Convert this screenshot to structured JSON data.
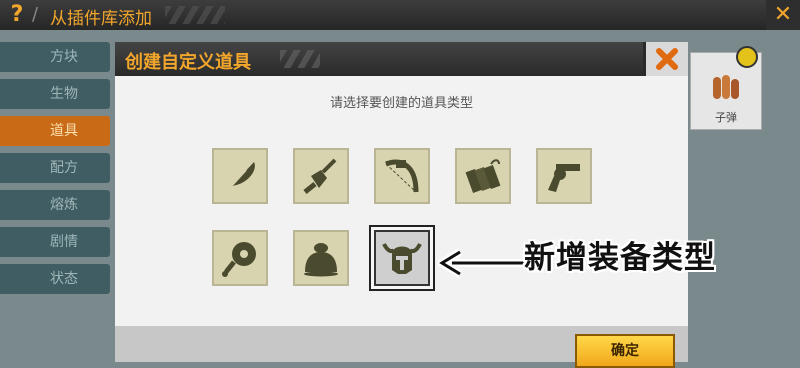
{
  "topbar": {
    "help_icon": "question-mark-icon",
    "title": "从插件库添加",
    "close_icon": "close-icon"
  },
  "sidebar": {
    "items": [
      {
        "label": "方块",
        "active": false
      },
      {
        "label": "生物",
        "active": false
      },
      {
        "label": "道具",
        "active": true
      },
      {
        "label": "配方",
        "active": false
      },
      {
        "label": "熔炼",
        "active": false
      },
      {
        "label": "剧情",
        "active": false
      },
      {
        "label": "状态",
        "active": false
      }
    ]
  },
  "side_card": {
    "label": "子弹",
    "icon": "bullets-icon"
  },
  "dialog": {
    "title": "创建自定义道具",
    "prompt": "请选择要创建的道具类型",
    "types": [
      {
        "icon": "feather-icon"
      },
      {
        "icon": "shovel-icon"
      },
      {
        "icon": "bow-icon"
      },
      {
        "icon": "dynamite-icon"
      },
      {
        "icon": "revolver-icon"
      },
      {
        "icon": "meat-icon"
      },
      {
        "icon": "food-bag-icon"
      },
      {
        "icon": "horned-helmet-icon",
        "selected": true
      }
    ],
    "confirm_label": "确定"
  },
  "annotation": {
    "text": "新增装备类型"
  },
  "colors": {
    "accent": "#f2a62c",
    "active_tab": "#c96a16",
    "tile": "#d8d4b0",
    "icon": "#4a4a2e"
  }
}
